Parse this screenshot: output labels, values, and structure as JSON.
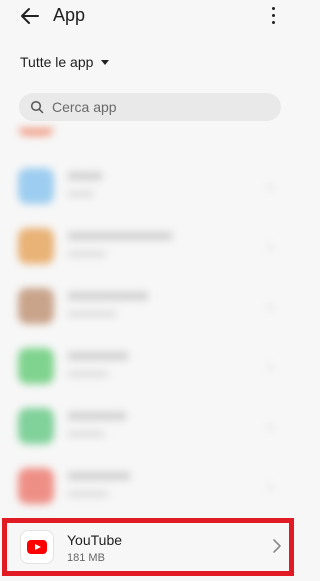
{
  "header": {
    "title": "App"
  },
  "filter": {
    "label": "Tutte le app"
  },
  "search": {
    "placeholder": "Cerca app"
  },
  "apps_blurred": [
    {
      "color": "#f0a08a"
    },
    {
      "color": "#9dcdf0"
    },
    {
      "color": "#e9b276"
    },
    {
      "color": "#c9a48b"
    },
    {
      "color": "#7fd38e"
    },
    {
      "color": "#80d19a"
    },
    {
      "color": "#ee8f86"
    }
  ],
  "highlighted_app": {
    "name": "YouTube",
    "size": "181 MB",
    "highlight_color": "#e01b24",
    "icon": "youtube-icon"
  }
}
